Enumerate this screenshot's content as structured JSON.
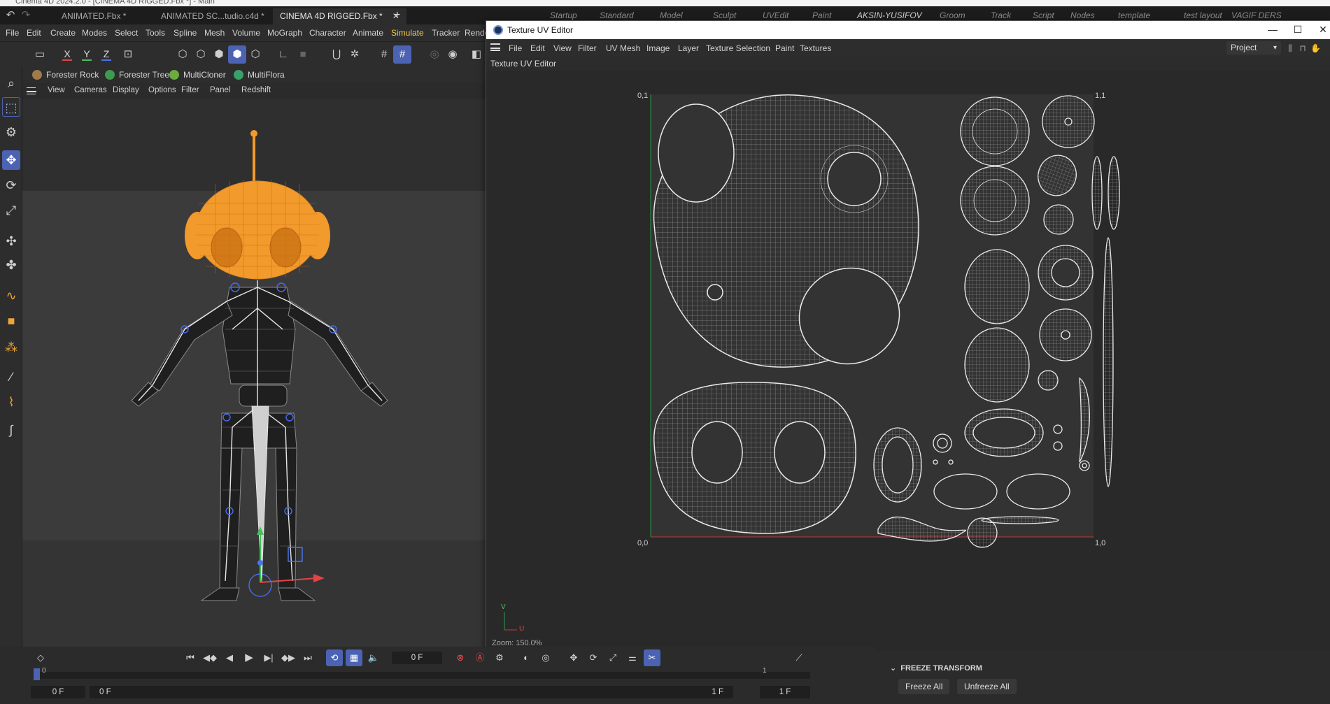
{
  "app": {
    "title_partial": "Cinema 4D 2024.2.0 - [CINEMA 4D RIGGED.Fbx *] - Main"
  },
  "tabs": [
    {
      "label": "ANIMATED.Fbx *"
    },
    {
      "label": "ANIMATED SC...tudio.c4d *"
    },
    {
      "label": "CINEMA 4D RIGGED.Fbx *"
    }
  ],
  "layouts": [
    "Startup",
    "Standard",
    "Model",
    "Sculpt",
    "UVEdit",
    "Paint",
    "AKSIN-YUSIFOV",
    "Groom",
    "Track",
    "Script",
    "Nodes",
    "template",
    "test layout",
    "VAGIF DERS"
  ],
  "menu": [
    "File",
    "Edit",
    "Create",
    "Modes",
    "Select",
    "Tools",
    "Spline",
    "Mesh",
    "Volume",
    "MoGraph",
    "Character",
    "Animate",
    "Simulate",
    "Tracker",
    "Rende"
  ],
  "toolbar": {
    "axis_x": "X",
    "axis_y": "Y",
    "axis_z": "Z"
  },
  "plugins": [
    "Forester Rock",
    "Forester Tree",
    "MultiCloner",
    "MultiFlora"
  ],
  "viewport_menu": [
    "View",
    "Cameras",
    "Display",
    "Options",
    "Filter",
    "Panel",
    "Redshift"
  ],
  "uv_editor": {
    "window_title": "Texture UV Editor",
    "menu": [
      "File",
      "Edit",
      "View",
      "Filter",
      "UV Mesh",
      "Image",
      "Layer",
      "Texture Selection",
      "Paint",
      "Textures"
    ],
    "project_select": "Project",
    "panel_label": "Texture UV Editor",
    "corners": {
      "top_left": "0,1",
      "top_right": "1,1",
      "bottom_left": "0,0",
      "bottom_right": "1,0"
    },
    "axis_v": "V",
    "axis_u": "U",
    "zoom": "Zoom: 150.0%"
  },
  "timeline": {
    "current_frame": "0 F",
    "start_field": "0 F",
    "start_min": "0 F",
    "end_field": "1 F",
    "end_max": "1 F",
    "ruler_0": "0",
    "ruler_1": "1"
  },
  "attributes": {
    "section": "FREEZE TRANSFORM",
    "freeze_all": "Freeze All",
    "unfreeze_all": "Unfreeze All"
  },
  "colors": {
    "accent": "#4c63b3",
    "head_orange": "#f39a2c",
    "simulate_menu": "#f2c84b",
    "u_axis": "#c03a3a",
    "v_axis": "#2f9a4a"
  }
}
